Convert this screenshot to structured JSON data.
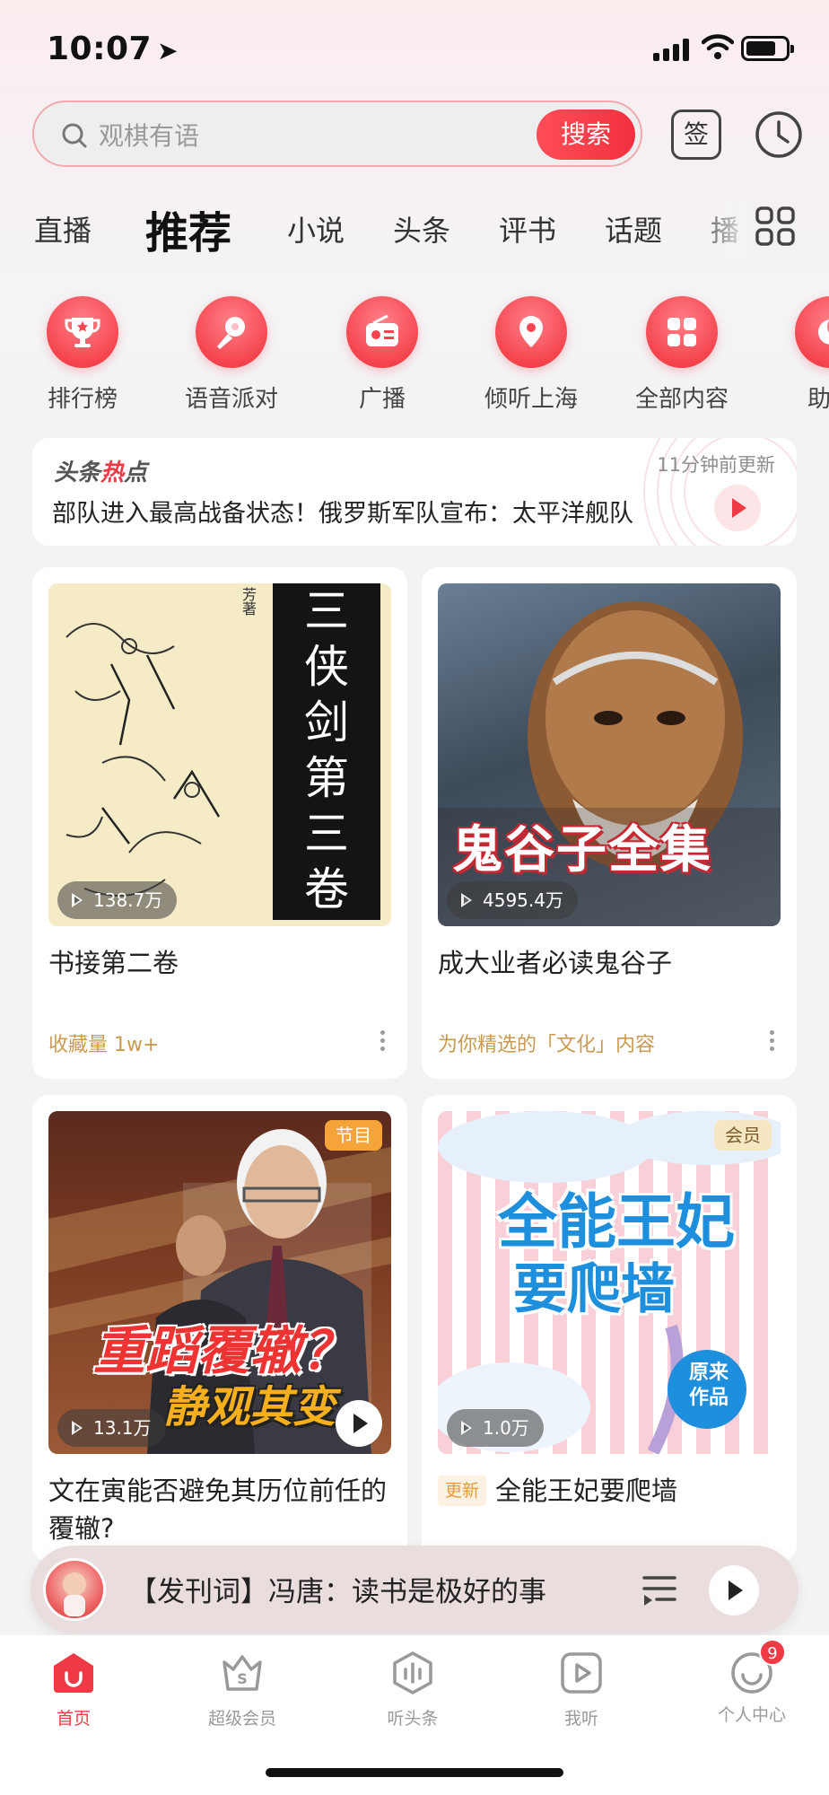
{
  "status_bar": {
    "time": "10:07"
  },
  "search": {
    "placeholder": "观棋有语",
    "button": "搜索",
    "sign_label": "签"
  },
  "tabs": [
    "直播",
    "推荐",
    "小说",
    "头条",
    "评书",
    "话题",
    "播"
  ],
  "categories": [
    {
      "label": "排行榜",
      "icon": "trophy-icon"
    },
    {
      "label": "语音派对",
      "icon": "microphone-icon"
    },
    {
      "label": "广播",
      "icon": "radio-icon"
    },
    {
      "label": "倾听上海",
      "icon": "location-pin-icon"
    },
    {
      "label": "全部内容",
      "icon": "grid-icon"
    },
    {
      "label": "助眠",
      "icon": "moon-icon"
    }
  ],
  "hot_news": {
    "brand_prefix": "头条",
    "brand_highlight": "热",
    "brand_suffix": "点",
    "updated": "11分钟前更新",
    "headline": "部队进入最高战备状态！俄罗斯军队宣布：太平洋舰队"
  },
  "cards": [
    {
      "title": "书接第二卷",
      "plays": "138.7万",
      "meta": "收藏量 1w+",
      "cover_text": "三侠剑第三卷",
      "cover_author": "芳著"
    },
    {
      "title": "成大业者必读鬼谷子",
      "plays": "4595.4万",
      "meta": "为你精选的「文化」内容",
      "cover_text": "鬼谷子全集"
    },
    {
      "title": "文在寅能否避免其历位前任的覆辙?",
      "plays": "13.1万",
      "tag": "节目",
      "cover_line1": "重蹈覆辙？",
      "cover_line2": "静观其变"
    },
    {
      "title": "全能王妃要爬墙",
      "plays": "1.0万",
      "tag": "会员",
      "update_tag": "更新",
      "cover_line1": "全能王妃",
      "cover_line2": "要爬墙",
      "cover_badge": "原来作品"
    }
  ],
  "player": {
    "title": "【发刊词】冯唐：读书是极好的事"
  },
  "nav": [
    {
      "label": "首页",
      "icon": "home-icon"
    },
    {
      "label": "超级会员",
      "icon": "vip-crown-icon"
    },
    {
      "label": "听头条",
      "icon": "audio-wave-icon"
    },
    {
      "label": "我听",
      "icon": "play-square-icon"
    },
    {
      "label": "个人中心",
      "icon": "profile-icon",
      "badge": "9"
    }
  ],
  "colors": {
    "accent": "#ef3a46",
    "meta": "#c99a52",
    "background": "#f3f3f4"
  }
}
